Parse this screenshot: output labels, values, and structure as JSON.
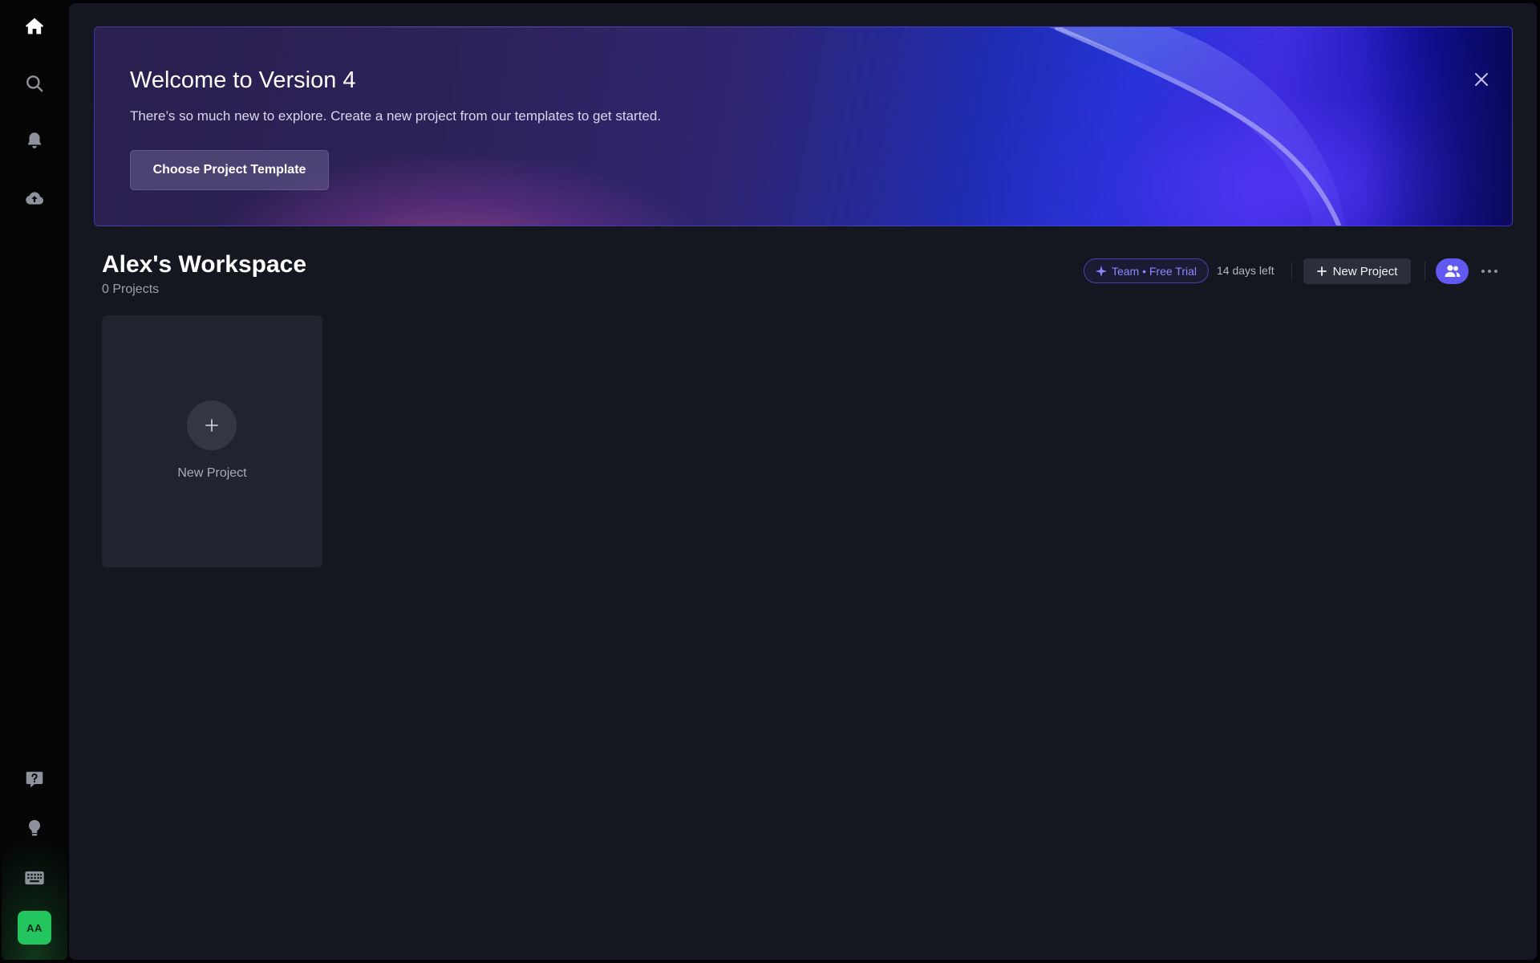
{
  "sidebar": {
    "top_icons": [
      "home-icon",
      "search-icon",
      "bell-icon",
      "cloud-upload-icon"
    ],
    "bottom_icons": [
      "help-icon",
      "lightbulb-icon",
      "keyboard-icon"
    ],
    "avatar_initials": "AA",
    "avatar_color": "#22c55e"
  },
  "banner": {
    "title": "Welcome to Version 4",
    "subtitle": "There’s so much new to explore. Create a new project from our templates to get started.",
    "cta_label": "Choose Project Template",
    "close_icon": "close-icon"
  },
  "workspace": {
    "title": "Alex's Workspace",
    "project_count": "0 Projects",
    "plan_badge": "Team • Free Trial",
    "plan_icon": "sparkle-icon",
    "days_left": "14 days left",
    "new_project_label": "New Project",
    "team_icon": "users-icon",
    "more_icon": "more-horizontal-icon"
  },
  "new_project_card": {
    "label": "New Project",
    "icon": "plus-icon"
  },
  "colors": {
    "accent": "#6259f2",
    "badge_text": "#8f87ff",
    "background": "#141720",
    "card": "#21242f"
  }
}
